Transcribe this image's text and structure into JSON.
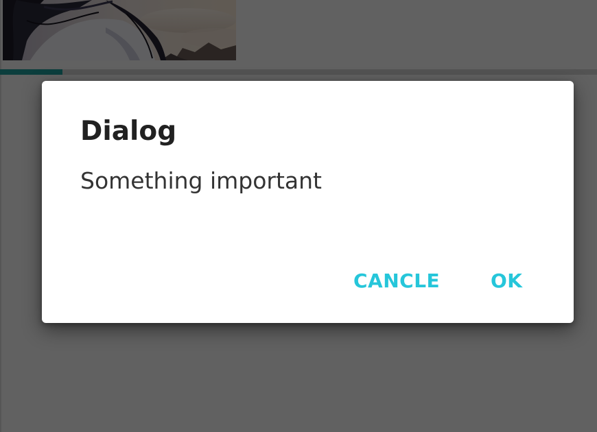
{
  "background": {
    "thumbnail_icon": "anime-artwork-image",
    "progress": 0.105,
    "progress_color": "#1e9c9a"
  },
  "dialog": {
    "title": "Dialog",
    "message": "Something important",
    "cancel_label": "CANCLE",
    "ok_label": "OK",
    "accent_color": "#26c6da"
  }
}
